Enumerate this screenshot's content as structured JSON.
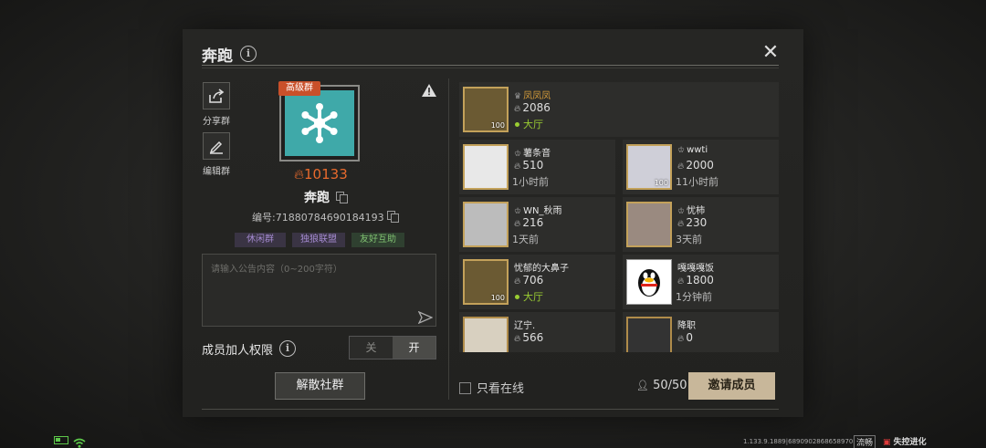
{
  "header": {
    "title": "奔跑",
    "close_label": "✕"
  },
  "side_actions": [
    {
      "label": "分享群",
      "icon": "share-icon"
    },
    {
      "label": "编辑群",
      "icon": "edit-icon"
    }
  ],
  "group": {
    "badge": "高级群",
    "heat": "10133",
    "name": "奔跑",
    "id_text": "编号:71880784690184193",
    "tags": [
      "休闲群",
      "独狼联盟",
      "友好互助"
    ],
    "notice_placeholder": "请输入公告内容（0~200字符）"
  },
  "permission": {
    "label": "成员加人权限",
    "off": "关",
    "on": "开",
    "selected": "开"
  },
  "disband_label": "解散社群",
  "members": [
    {
      "name": "凤凤凤",
      "heat": "2086",
      "status": "大厅",
      "online": true,
      "owner": true,
      "level": "100"
    },
    {
      "name": "薯条音",
      "heat": "510",
      "status": "1小时前",
      "online": false,
      "owner": false,
      "level": ""
    },
    {
      "name": "wwti",
      "heat": "2000",
      "status": "11小时前",
      "online": false,
      "owner": false,
      "level": "100"
    },
    {
      "name": "WN_秋雨",
      "heat": "216",
      "status": "1天前",
      "online": false,
      "owner": false,
      "level": ""
    },
    {
      "name": "忧柿",
      "heat": "230",
      "status": "3天前",
      "online": false,
      "owner": false,
      "level": ""
    },
    {
      "name": "忧郁的大鼻子",
      "heat": "706",
      "status": "大厅",
      "online": true,
      "owner": false,
      "level": "100"
    },
    {
      "name": "嘎嘎嘎饭",
      "heat": "1800",
      "status": "1分钟前",
      "online": false,
      "owner": false,
      "level": ""
    },
    {
      "name": "辽宁.",
      "heat": "566",
      "status": "",
      "online": false,
      "owner": false,
      "level": ""
    },
    {
      "name": "降职",
      "heat": "0",
      "status": "",
      "online": false,
      "owner": false,
      "level": ""
    }
  ],
  "footer": {
    "only_online": "只看在线",
    "member_count": "50/50",
    "invite_label": "邀请成员"
  },
  "status_bar": {
    "version": "1.133.9.1889|6890902868658970",
    "fluency": "流畅",
    "brand": "失控进化"
  }
}
